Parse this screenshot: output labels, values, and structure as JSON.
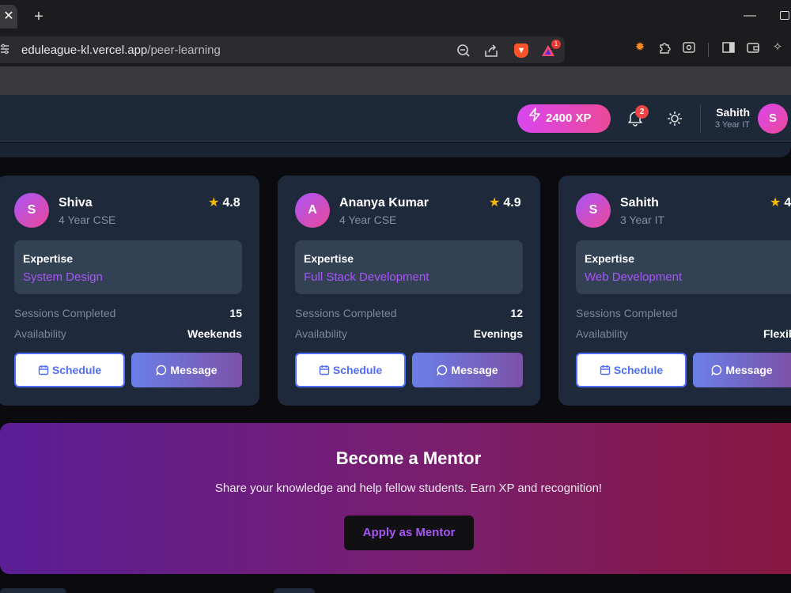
{
  "browser": {
    "tab_close": "✕",
    "new_tab": "+",
    "url_host": "eduleague-kl.vercel.app",
    "url_path": "/peer-learning",
    "extension_badge": "1"
  },
  "header": {
    "xp": "2400 XP",
    "notification_count": "2",
    "user": {
      "name": "Sahith",
      "year": "3 Year IT",
      "avatar_initial": "S"
    }
  },
  "mentors": [
    {
      "initial": "S",
      "name": "Shiva",
      "year": "4 Year CSE",
      "rating": "4.8",
      "expertise_label": "Expertise",
      "expertise": "System Design",
      "sessions_label": "Sessions Completed",
      "sessions": "15",
      "availability_label": "Availability",
      "availability": "Weekends",
      "schedule_label": "Schedule",
      "message_label": "Message"
    },
    {
      "initial": "A",
      "name": "Ananya Kumar",
      "year": "4 Year CSE",
      "rating": "4.9",
      "expertise_label": "Expertise",
      "expertise": "Full Stack Development",
      "sessions_label": "Sessions Completed",
      "sessions": "12",
      "availability_label": "Availability",
      "availability": "Evenings",
      "schedule_label": "Schedule",
      "message_label": "Message"
    },
    {
      "initial": "S",
      "name": "Sahith",
      "year": "3 Year IT",
      "rating": "4",
      "expertise_label": "Expertise",
      "expertise": "Web Development",
      "sessions_label": "Sessions Completed",
      "sessions": "",
      "availability_label": "Availability",
      "availability": "Flexib",
      "schedule_label": "Schedule",
      "message_label": "Message"
    }
  ],
  "banner": {
    "title": "Become a Mentor",
    "subtitle": "Share your knowledge and help fellow students. Earn XP and recognition!",
    "button": "Apply as Mentor"
  },
  "colors": {
    "accent_purple": "#a855f7",
    "xp_gradient": [
      "#d946ef",
      "#ec4899"
    ],
    "card_bg": "#1e293b",
    "header_bg": "#1d2838"
  },
  "icons": [
    "close-icon",
    "plus-icon",
    "site-settings-icon",
    "zoom-out-icon",
    "share-icon",
    "brave-shield-icon",
    "brave-rewards-icon",
    "extension-sun-icon",
    "puzzle-icon",
    "screenshot-icon",
    "sidebar-icon",
    "wallet-icon",
    "leo-icon",
    "bolt-icon",
    "bell-icon",
    "sun-icon",
    "star-icon",
    "calendar-icon",
    "message-icon"
  ]
}
